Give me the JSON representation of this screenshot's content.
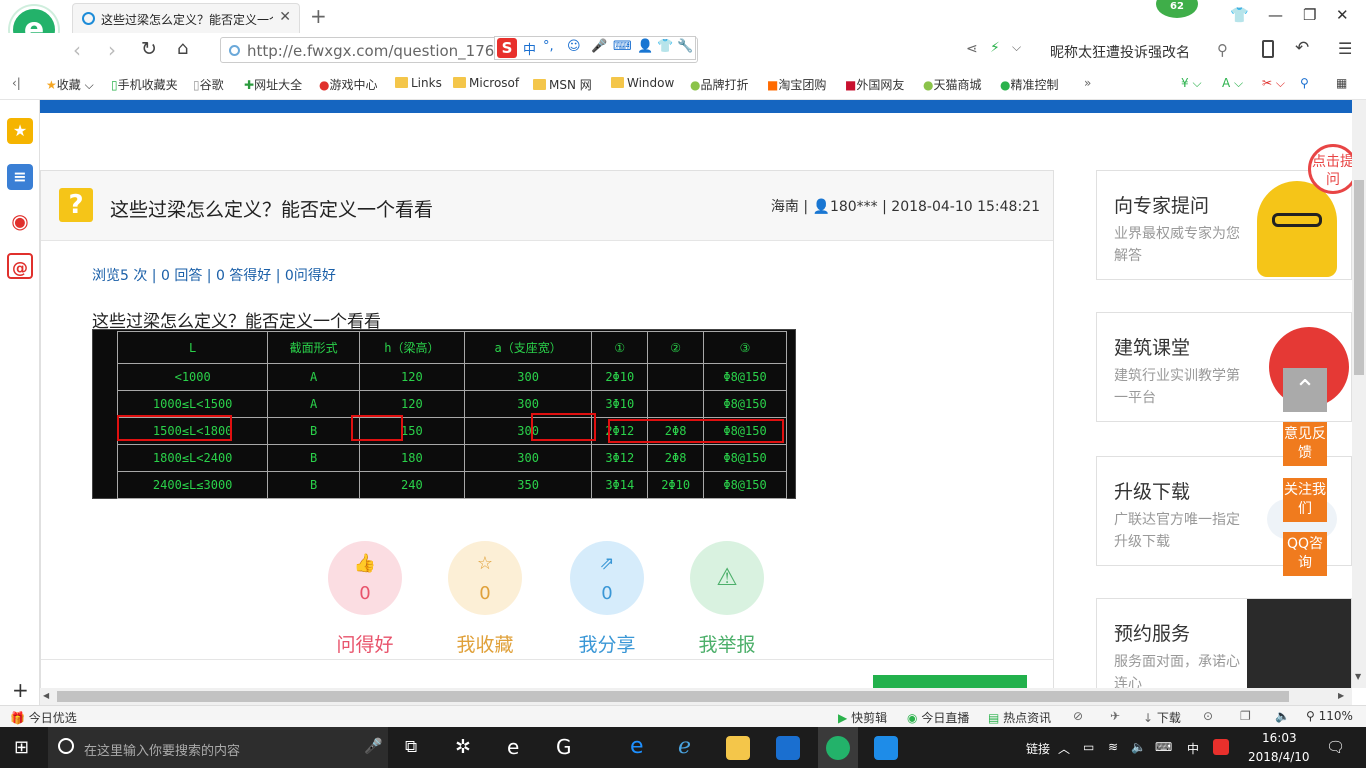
{
  "browser": {
    "tab_title": "这些过梁怎么定义？能否定义一个",
    "url": "http://e.fwxgx.com/question_176",
    "nickname": "昵称太狂遭投诉强改名",
    "badge": "62",
    "accent": "#1565c0"
  },
  "bookmarks": [
    "收藏",
    "手机收藏夹",
    "谷歌",
    "网址大全",
    "游戏中心",
    "Links",
    "Microsof",
    "MSN 网",
    "Window",
    "品牌打折",
    "淘宝团购",
    "外国网友",
    "天猫商城",
    "精准控制"
  ],
  "question": {
    "title": "这些过梁怎么定义？能否定义一个看看",
    "location": "海南",
    "user": "180***",
    "datetime": "2018-04-10 15:48:21",
    "stats": "浏览5 次 | 0 回答 | 0 答得好 | 0问得好",
    "body": "这些过梁怎么定义？能否定义一个看看"
  },
  "cad_table": {
    "headers": [
      "L",
      "截面形式",
      "h（梁高）",
      "a（支座宽）",
      "①",
      "②",
      "③"
    ],
    "rows": [
      [
        "<1000",
        "A",
        "120",
        "300",
        "2Φ10",
        "",
        "Φ8@150"
      ],
      [
        "1000≤L<1500",
        "A",
        "120",
        "300",
        "3Φ10",
        "",
        "Φ8@150"
      ],
      [
        "1500≤L<1800",
        "B",
        "150",
        "300",
        "2Φ12",
        "2Φ8",
        "Φ8@150"
      ],
      [
        "1800≤L<2400",
        "B",
        "180",
        "300",
        "3Φ12",
        "2Φ8",
        "Φ8@150"
      ],
      [
        "2400≤L≤3000",
        "B",
        "240",
        "350",
        "3Φ14",
        "2Φ10",
        "Φ8@150"
      ]
    ]
  },
  "actions": [
    {
      "label": "问得好",
      "count": "0",
      "color": "#e8536b",
      "bg": "#fbdde2"
    },
    {
      "label": "我收藏",
      "count": "0",
      "color": "#e0a13a",
      "bg": "#fcefd6"
    },
    {
      "label": "我分享",
      "count": "0",
      "color": "#3a97d6",
      "bg": "#d6ecfb"
    },
    {
      "label": "我举报",
      "count": "",
      "color": "#4caf6a",
      "bg": "#d9f2e0"
    }
  ],
  "right_cards": [
    {
      "title": "向专家提问",
      "desc": "业界最权威专家为您解答"
    },
    {
      "title": "建筑课堂",
      "desc": "建筑行业实训教学第一平台"
    },
    {
      "title": "升级下载",
      "desc": "广联达官方唯一指定升级下载"
    },
    {
      "title": "预约服务",
      "desc": "服务面对面，承诺心连心"
    }
  ],
  "bubble": "点击提问",
  "float_buttons": [
    "意见反馈",
    "关注我们",
    "QQ咨询"
  ],
  "status_bar": {
    "left": "今日优选",
    "items": [
      "快剪辑",
      "今日直播",
      "热点资讯",
      "下载"
    ],
    "zoom": "110%"
  },
  "taskbar": {
    "search_placeholder": "在这里输入你要搜索的内容",
    "tray_link": "链接",
    "ime": "中",
    "time": "16:03",
    "date": "2018/4/10"
  }
}
